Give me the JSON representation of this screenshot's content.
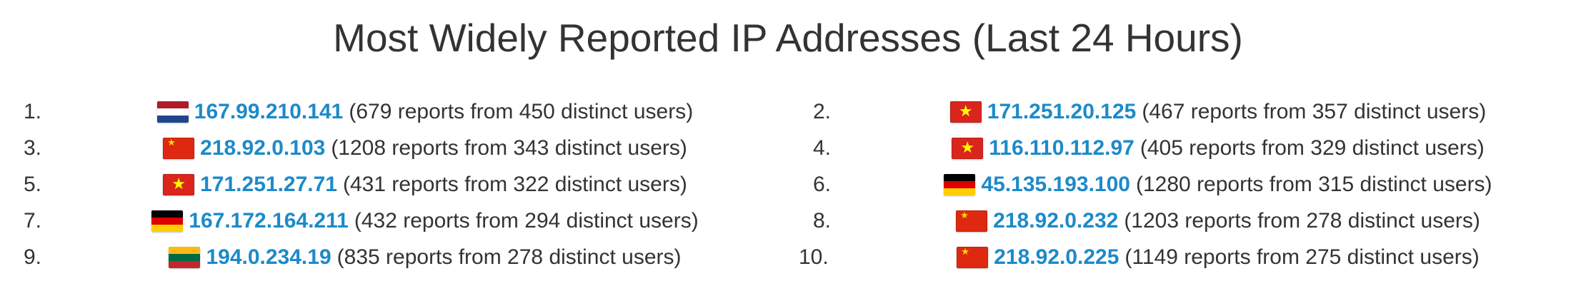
{
  "page": {
    "title": "Most Widely Reported IP Addresses (Last 24 Hours)"
  },
  "colors": {
    "link": "#1c8ac9",
    "text": "#333333"
  },
  "entries": [
    {
      "rank": "1.",
      "ip": "167.99.210.141",
      "info": "(679 reports from 450 distinct users)",
      "flag": "netherlands-flag-icon",
      "column": "left"
    },
    {
      "rank": "2.",
      "ip": "171.251.20.125",
      "info": "(467 reports from 357 distinct users)",
      "flag": "vietnam-flag-icon",
      "column": "right"
    },
    {
      "rank": "3.",
      "ip": "218.92.0.103",
      "info": "(1208 reports from 343 distinct users)",
      "flag": "china-flag-icon",
      "column": "left"
    },
    {
      "rank": "4.",
      "ip": "116.110.112.97",
      "info": "(405 reports from 329 distinct users)",
      "flag": "vietnam-flag-icon",
      "column": "right"
    },
    {
      "rank": "5.",
      "ip": "171.251.27.71",
      "info": "(431 reports from 322 distinct users)",
      "flag": "vietnam-flag-icon",
      "column": "left"
    },
    {
      "rank": "6.",
      "ip": "45.135.193.100",
      "info": "(1280 reports from 315 distinct users)",
      "flag": "germany-flag-icon",
      "column": "right"
    },
    {
      "rank": "7.",
      "ip": "167.172.164.211",
      "info": "(432 reports from 294 distinct users)",
      "flag": "germany-flag-icon",
      "column": "left"
    },
    {
      "rank": "8.",
      "ip": "218.92.0.232",
      "info": "(1203 reports from 278 distinct users)",
      "flag": "china-flag-icon",
      "column": "right"
    },
    {
      "rank": "9.",
      "ip": "194.0.234.19",
      "info": "(835 reports from 278 distinct users)",
      "flag": "lithuania-flag-icon",
      "column": "left"
    },
    {
      "rank": "10.",
      "ip": "218.92.0.225",
      "info": "(1149 reports from 275 distinct users)",
      "flag": "china-flag-icon",
      "column": "right"
    }
  ]
}
